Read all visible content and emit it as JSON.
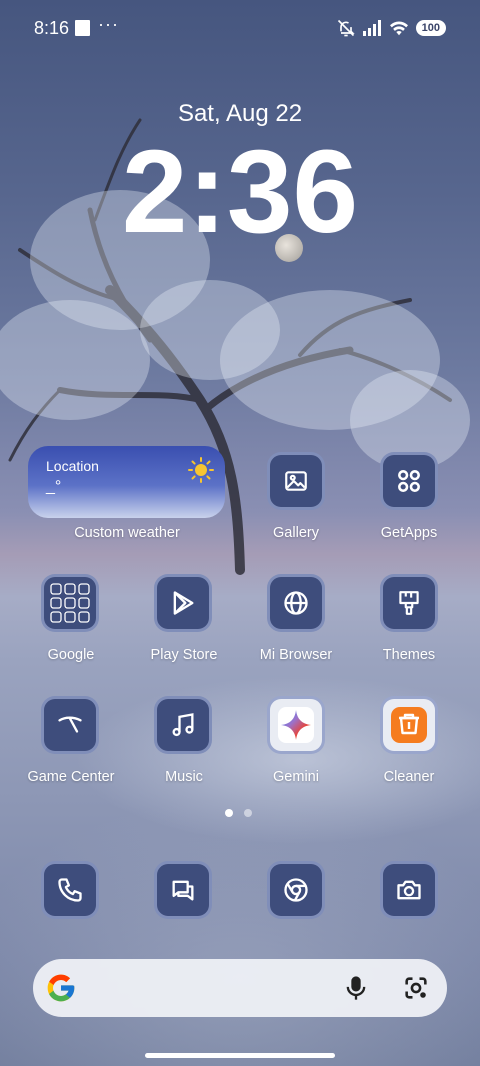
{
  "status_bar": {
    "time": "8:16",
    "more": "···",
    "battery": "100"
  },
  "lock": {
    "date": "Sat, Aug 22",
    "time": "2:36"
  },
  "weather_widget": {
    "location": "Location",
    "temperature": "_°",
    "label": "Custom weather"
  },
  "apps": {
    "gallery": "Gallery",
    "getapps": "GetApps",
    "google": "Google",
    "play_store": "Play Store",
    "mi_browser": "Mi Browser",
    "themes": "Themes",
    "game_center": "Game Center",
    "music": "Music",
    "gemini": "Gemini",
    "cleaner": "Cleaner"
  },
  "dock": [
    "phone-icon",
    "messages-icon",
    "chrome-icon",
    "camera-icon"
  ],
  "page_indicator": {
    "pages": 2,
    "current": 1
  },
  "search": {
    "logo": "google-g-icon"
  },
  "colors": {
    "tile_bg": "#3e4d7c",
    "tile_border": "#8c9ac4",
    "cleaner": "#f57c1f"
  }
}
